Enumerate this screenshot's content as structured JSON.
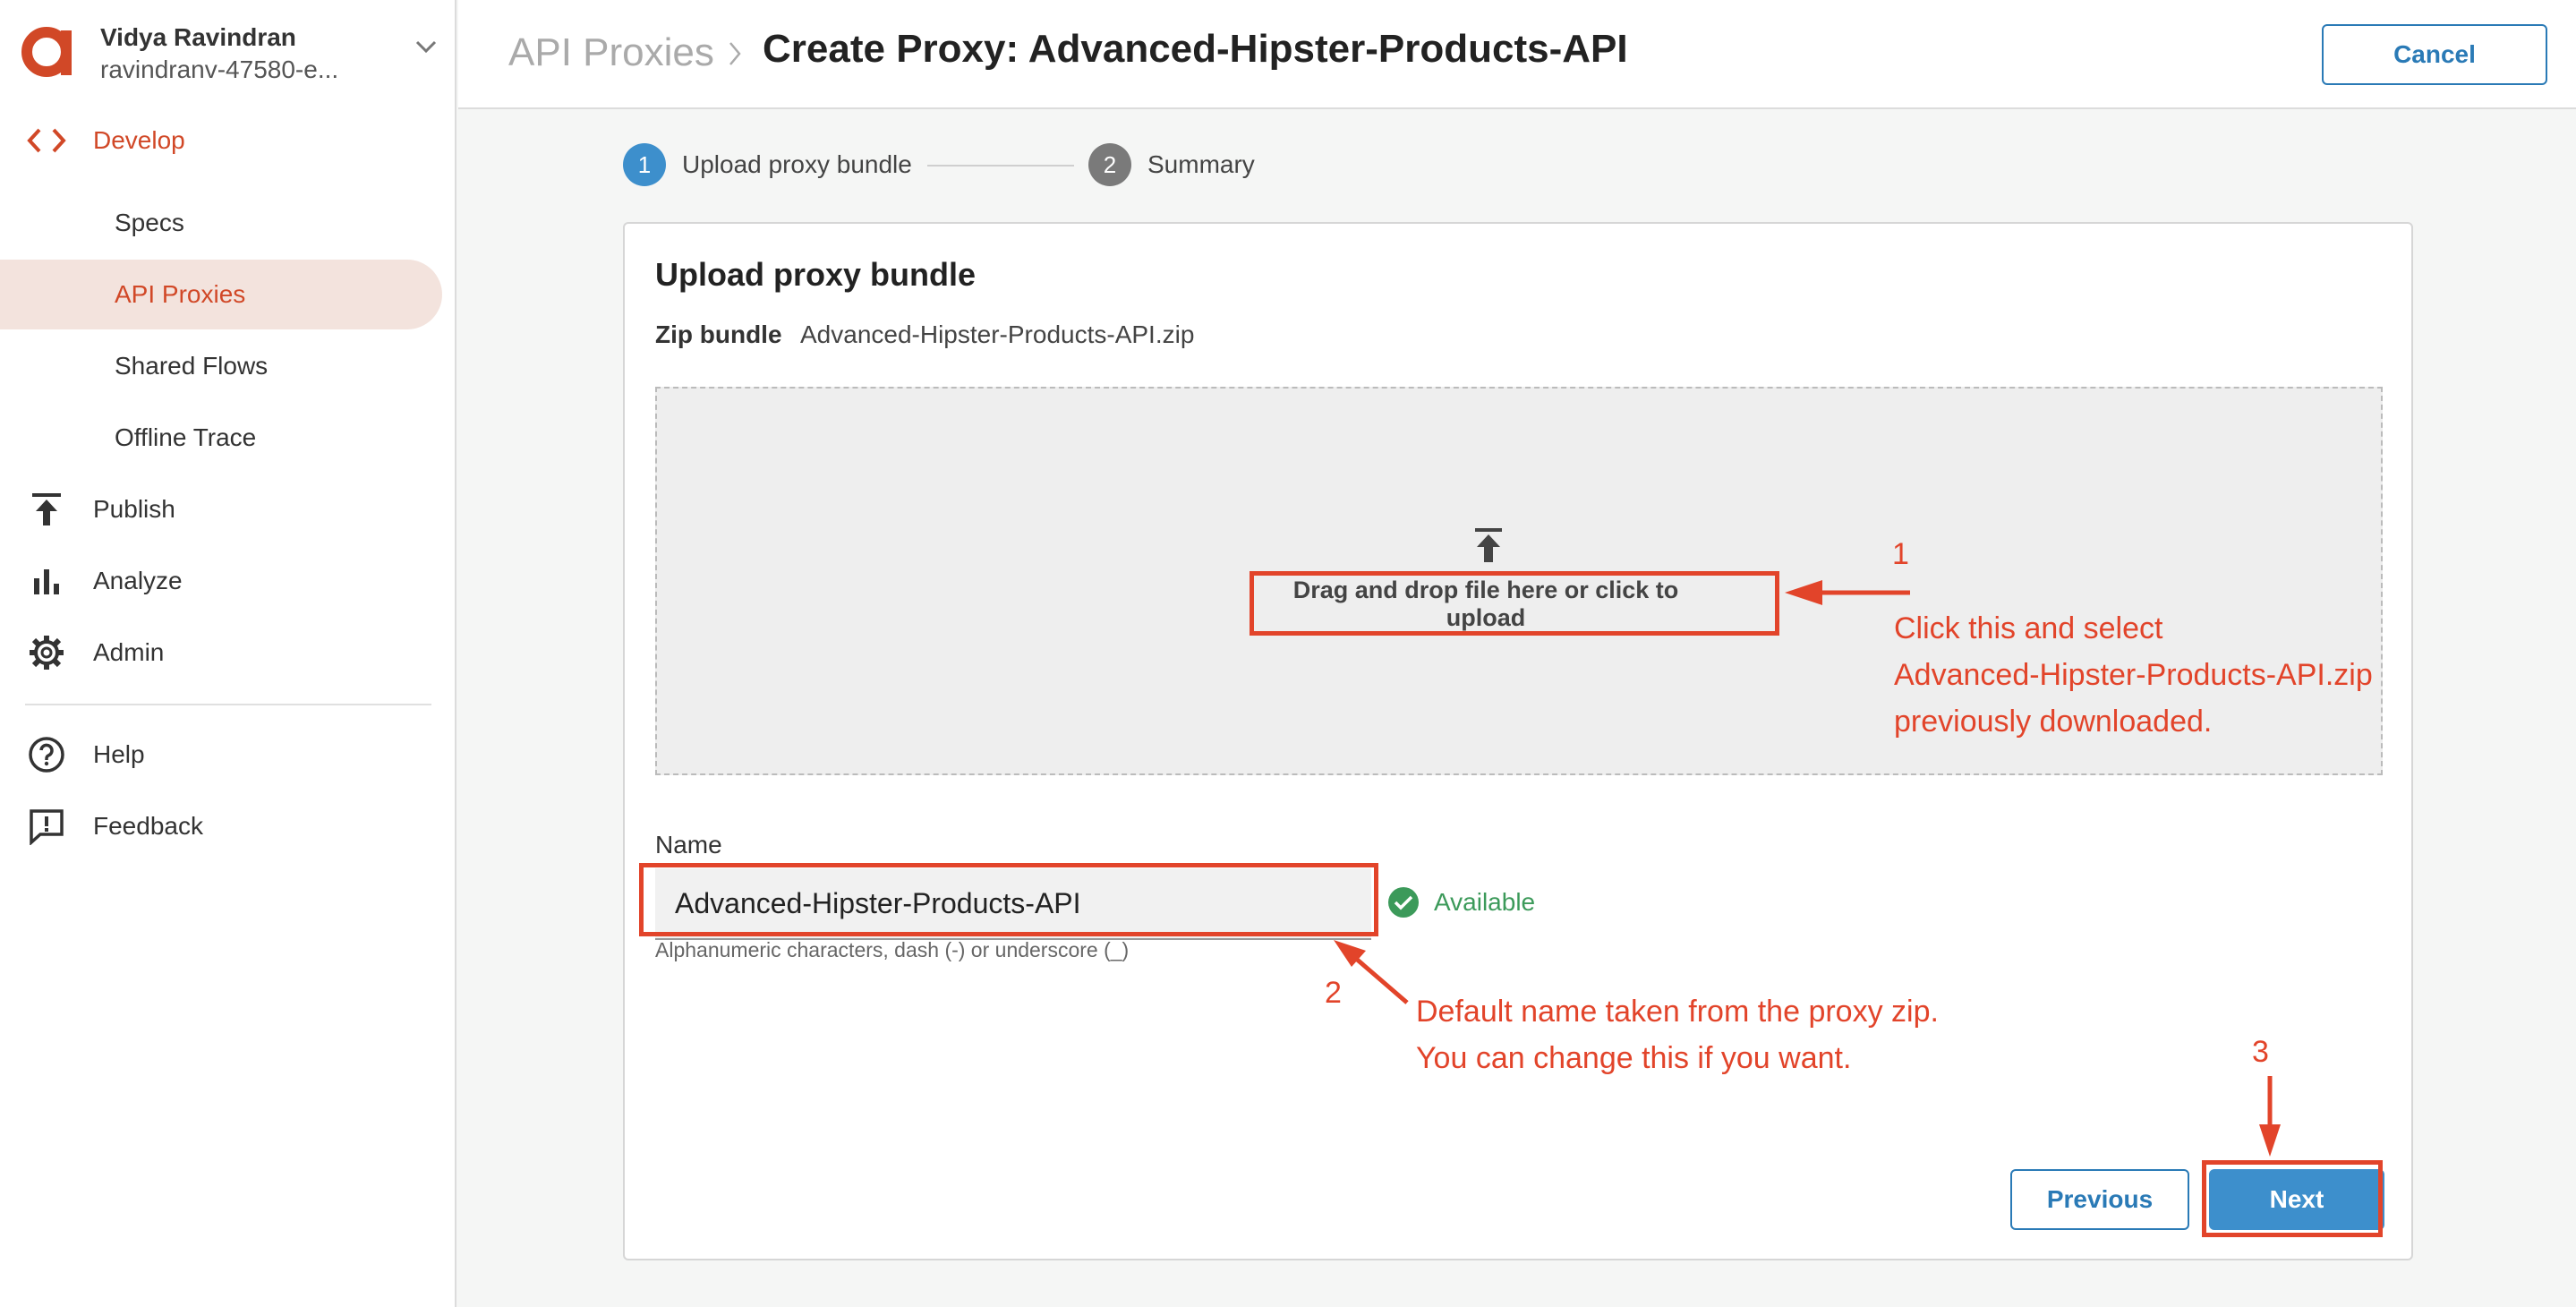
{
  "account": {
    "name": "Vidya Ravindran",
    "org": "ravindranv-47580-e..."
  },
  "sidebar": {
    "develop": "Develop",
    "items": [
      {
        "label": "Specs"
      },
      {
        "label": "API Proxies"
      },
      {
        "label": "Shared Flows"
      },
      {
        "label": "Offline Trace"
      }
    ],
    "publish": "Publish",
    "analyze": "Analyze",
    "admin": "Admin",
    "help": "Help",
    "feedback": "Feedback"
  },
  "header": {
    "breadcrumb": "API Proxies",
    "title": "Create Proxy: Advanced-Hipster-Products-API",
    "cancel_label": "Cancel"
  },
  "stepper": [
    {
      "num": "1",
      "label": "Upload proxy bundle"
    },
    {
      "num": "2",
      "label": "Summary"
    }
  ],
  "card": {
    "title": "Upload proxy bundle",
    "zip_label": "Zip bundle",
    "zip_value": "Advanced-Hipster-Products-API.zip",
    "dropzone_text": "Drag and drop file here or click to upload",
    "name_label": "Name",
    "name_value": "Advanced-Hipster-Products-API",
    "available": "Available",
    "hint": "Alphanumeric characters, dash (-) or underscore (_)",
    "previous_label": "Previous",
    "next_label": "Next"
  },
  "annotations": {
    "n1": "1",
    "t1": "Click this and select\nAdvanced-Hipster-Products-API.zip\npreviously downloaded.",
    "n2": "2",
    "t2": "Default name taken from the proxy zip.\nYou can change this if you want.",
    "n3": "3"
  },
  "colors": {
    "accent": "#d14827",
    "primary": "#3d8fcc",
    "annotation": "#e2442a",
    "success": "#3c9a5a"
  }
}
